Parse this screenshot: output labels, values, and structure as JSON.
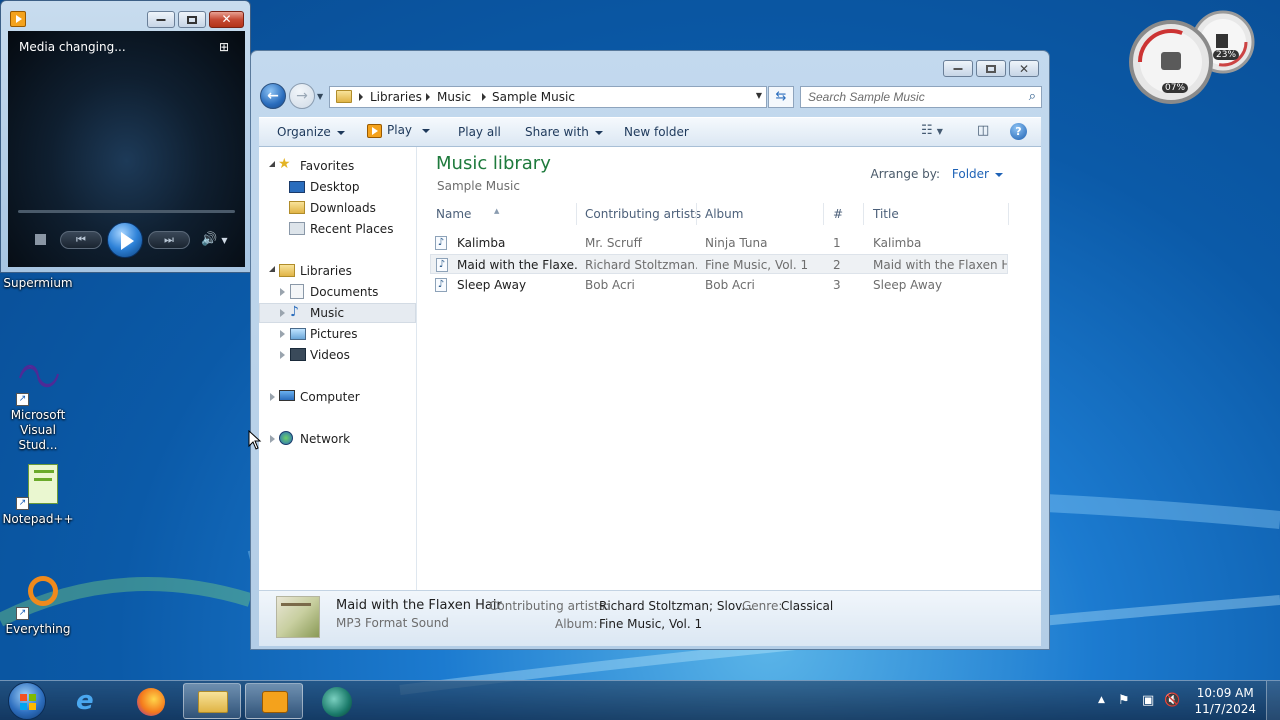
{
  "desktop": {
    "icons": [
      {
        "label": "Supermium"
      },
      {
        "label": "Microsoft Visual Stud..."
      },
      {
        "label": "Notepad++"
      },
      {
        "label": "Everything"
      }
    ],
    "gadget": {
      "cpu": "07%",
      "mem": "23%"
    }
  },
  "media_player": {
    "status": "Media changing..."
  },
  "explorer": {
    "address": {
      "crumbs": [
        "Libraries",
        "Music",
        "Sample Music"
      ]
    },
    "search": {
      "placeholder": "Search Sample Music"
    },
    "toolbar": {
      "organize": "Organize",
      "play": "Play",
      "play_all": "Play all",
      "share_with": "Share with",
      "new_folder": "New folder"
    },
    "nav": {
      "favorites": "Favorites",
      "desktop": "Desktop",
      "downloads": "Downloads",
      "recent_places": "Recent Places",
      "libraries": "Libraries",
      "documents": "Documents",
      "music": "Music",
      "pictures": "Pictures",
      "videos": "Videos",
      "computer": "Computer",
      "network": "Network"
    },
    "main": {
      "title": "Music library",
      "subtitle": "Sample Music",
      "arrange_label": "Arrange by:",
      "arrange_value": "Folder",
      "columns": {
        "name": "Name",
        "artists": "Contributing artists",
        "album": "Album",
        "number": "#",
        "title": "Title"
      },
      "rows": [
        {
          "name": "Kalimba",
          "artists": "Mr. Scruff",
          "album": "Ninja Tuna",
          "number": "1",
          "title": "Kalimba"
        },
        {
          "name": "Maid with the Flaxe...",
          "artists": "Richard Stoltzman...",
          "album": "Fine Music, Vol. 1",
          "number": "2",
          "title": "Maid with the Flaxen H..."
        },
        {
          "name": "Sleep Away",
          "artists": "Bob Acri",
          "album": "Bob Acri",
          "number": "3",
          "title": "Sleep Away"
        }
      ]
    },
    "details": {
      "title": "Maid with the Flaxen Hair",
      "type": "MP3 Format Sound",
      "artists_label": "Contributing artists:",
      "artists_value": "Richard Stoltzman; Slov...",
      "genre_label": "Genre:",
      "genre_value": "Classical",
      "album_label": "Album:",
      "album_value": "Fine Music, Vol. 1"
    }
  },
  "taskbar": {
    "clock_time": "10:09 AM",
    "clock_date": "11/7/2024"
  }
}
